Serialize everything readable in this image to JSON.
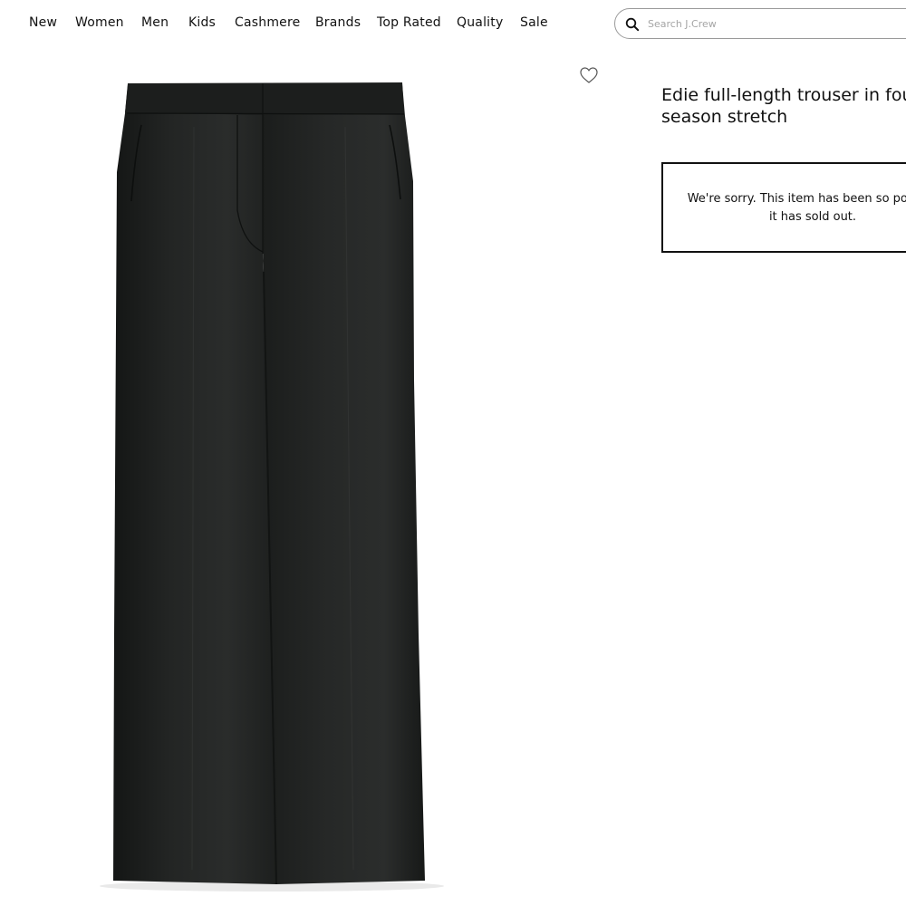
{
  "nav": {
    "items": [
      {
        "label": "New"
      },
      {
        "label": "Women"
      },
      {
        "label": "Men"
      },
      {
        "label": "Kids"
      },
      {
        "label": "Cashmere"
      },
      {
        "label": "Brands"
      },
      {
        "label": "Top Rated"
      },
      {
        "label": "Quality"
      },
      {
        "label": "Sale"
      }
    ]
  },
  "search": {
    "placeholder": "Search J.Crew",
    "value": "",
    "icon": "search-icon"
  },
  "product": {
    "image_alt": "Black full-length trousers",
    "wishlist_icon": "heart-outline-icon",
    "title_line1": "Edie full-length trouser in four-",
    "title_line2": "season stretch",
    "soldout_line1": "We're sorry. This item has been so popular",
    "soldout_line2": "it has sold out."
  },
  "colors": {
    "trouser": "#1f2120",
    "text": "#111111",
    "border": "#111111"
  }
}
